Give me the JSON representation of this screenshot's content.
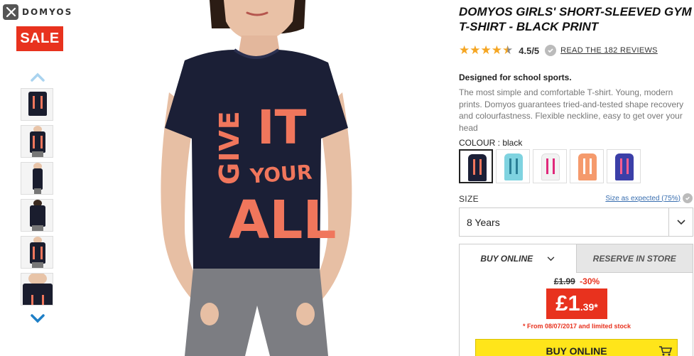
{
  "brand": {
    "name": "DOMYOS"
  },
  "sale_badge": "SALE",
  "product": {
    "title": "DOMYOS GIRLS' SHORT-SLEEVED GYM T-SHIRT - BLACK PRINT",
    "rating": {
      "stars": 4.5,
      "score_text": "4.5/5",
      "reviews_link": "READ THE 182 REVIEWS"
    },
    "tagline": "Designed for school sports.",
    "description": "The most simple and comfortable T-shirt. Young, modern prints. Domyos guarantees tried-and-tested shape recovery and colourfastness. Flexible neckline, easy to get over your head",
    "print_text": {
      "line1": "GIVE",
      "line2": "IT",
      "line3": "YOUR",
      "line4": "ALL"
    }
  },
  "colour": {
    "label": "COLOUR : ",
    "selected": "black",
    "swatches": [
      {
        "name": "black",
        "shirt": "#1b1f36",
        "print": "#f0765c"
      },
      {
        "name": "turquoise",
        "shirt": "#7fd3e0",
        "print": "#2a7f96"
      },
      {
        "name": "white",
        "shirt": "#f2f2f2",
        "print": "#e0287a"
      },
      {
        "name": "orange",
        "shirt": "#f59a6c",
        "print": "#ffffff"
      },
      {
        "name": "blue",
        "shirt": "#3b3fa8",
        "print": "#ff5d8f"
      }
    ]
  },
  "size": {
    "label": "SIZE",
    "guide_link": "Size as expected (75%)",
    "selected": "8 Years"
  },
  "purchase": {
    "tab_online": "BUY ONLINE",
    "tab_store": "RESERVE IN STORE",
    "old_price": "£1.99",
    "discount": "-30%",
    "price_main": "£1",
    "price_cents": ".39*",
    "note": "* From 08/07/2017 and limited stock",
    "buy_button": "BUY ONLINE"
  },
  "colors": {
    "accent_red": "#e8321e",
    "buy_yellow": "#ffe51a",
    "star": "#f5a623",
    "link_blue": "#3a6fb0"
  }
}
